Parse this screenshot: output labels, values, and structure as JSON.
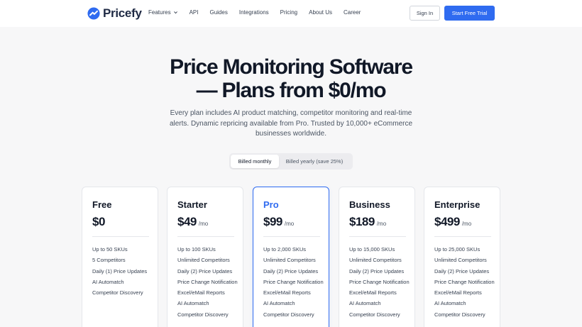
{
  "brand": {
    "name": "Pricefy",
    "accent": "#2f6bf0"
  },
  "nav": {
    "links": [
      "Features",
      "API",
      "Guides",
      "Integrations",
      "Pricing",
      "About Us",
      "Career"
    ],
    "sign_in": "Sign In",
    "cta": "Start Free Trial"
  },
  "hero": {
    "title_line1": "Price Monitoring Software",
    "title_line2": "— Plans from $0/mo",
    "subtitle": "Every plan includes AI product matching, competitor monitoring and real-time alerts. Dynamic repricing available from Pro. Trusted by 10,000+ eCommerce businesses worldwide."
  },
  "billing": {
    "monthly": "Billed monthly",
    "yearly": "Billed yearly (save 25%)",
    "selected": "monthly"
  },
  "plans": [
    {
      "name": "Free",
      "price": "$0",
      "per": "",
      "features": [
        "Up to 50 SKUs",
        "5 Competitors",
        "Daily (1) Price Updates",
        "AI Automatch",
        "Competitor Discovery"
      ]
    },
    {
      "name": "Starter",
      "price": "$49",
      "per": "/mo",
      "features": [
        "Up to 100 SKUs",
        "Unlimited Competitors",
        "Daily (2) Price Updates",
        "Price Change Notification",
        "Excel/eMail Reports",
        "AI Automatch",
        "Competitor Discovery"
      ]
    },
    {
      "name": "Pro",
      "price": "$99",
      "per": "/mo",
      "featured": true,
      "features": [
        "Up to 2,000 SKUs",
        "Unlimited Competitors",
        "Daily (2) Price Updates",
        "Price Change Notification",
        "Excel/eMail Reports",
        "AI Automatch",
        "Competitor Discovery"
      ]
    },
    {
      "name": "Business",
      "price": "$189",
      "per": "/mo",
      "features": [
        "Up to 15,000 SKUs",
        "Unlimited Competitors",
        "Daily (2) Price Updates",
        "Price Change Notification",
        "Excel/eMail Reports",
        "AI Automatch",
        "Competitor Discovery"
      ]
    },
    {
      "name": "Enterprise",
      "price": "$499",
      "per": "/mo",
      "features": [
        "Up to 25,000 SKUs",
        "Unlimited Competitors",
        "Daily (2) Price Updates",
        "Price Change Notification",
        "Excel/eMail Reports",
        "AI Automatch",
        "Competitor Discovery"
      ]
    }
  ]
}
